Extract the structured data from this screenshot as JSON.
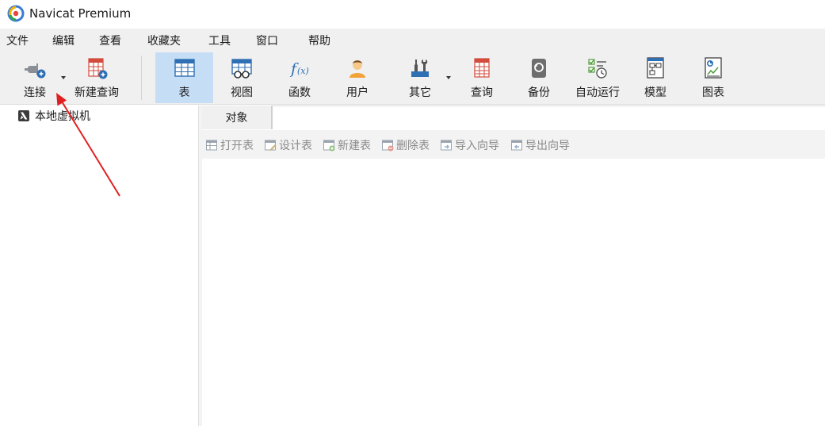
{
  "window": {
    "title": "Navicat Premium"
  },
  "menu": [
    "文件",
    "编辑",
    "查看",
    "收藏夹",
    "工具",
    "窗口",
    "帮助"
  ],
  "toolbar": {
    "connect": "连接",
    "new_query": "新建查询",
    "table": "表",
    "view": "视图",
    "function": "函数",
    "user": "用户",
    "other": "其它",
    "query": "查询",
    "backup": "备份",
    "automation": "自动运行",
    "model": "模型",
    "chart": "图表"
  },
  "navigator": {
    "connections": [
      "本地虚拟机"
    ]
  },
  "tabs": {
    "objects": "对象"
  },
  "object_toolbar": {
    "open_table": "打开表",
    "design_table": "设计表",
    "new_table": "新建表",
    "delete_table": "删除表",
    "import_wizard": "导入向导",
    "export_wizard": "导出向导"
  },
  "colors": {
    "active_tool": "#c5def5",
    "toolbar_bg": "#f0f0f0",
    "annotation_arrow": "#e02020",
    "icon_blue": "#2f6fb3",
    "icon_red": "#d24b3c",
    "icon_green": "#4f9b3a"
  }
}
